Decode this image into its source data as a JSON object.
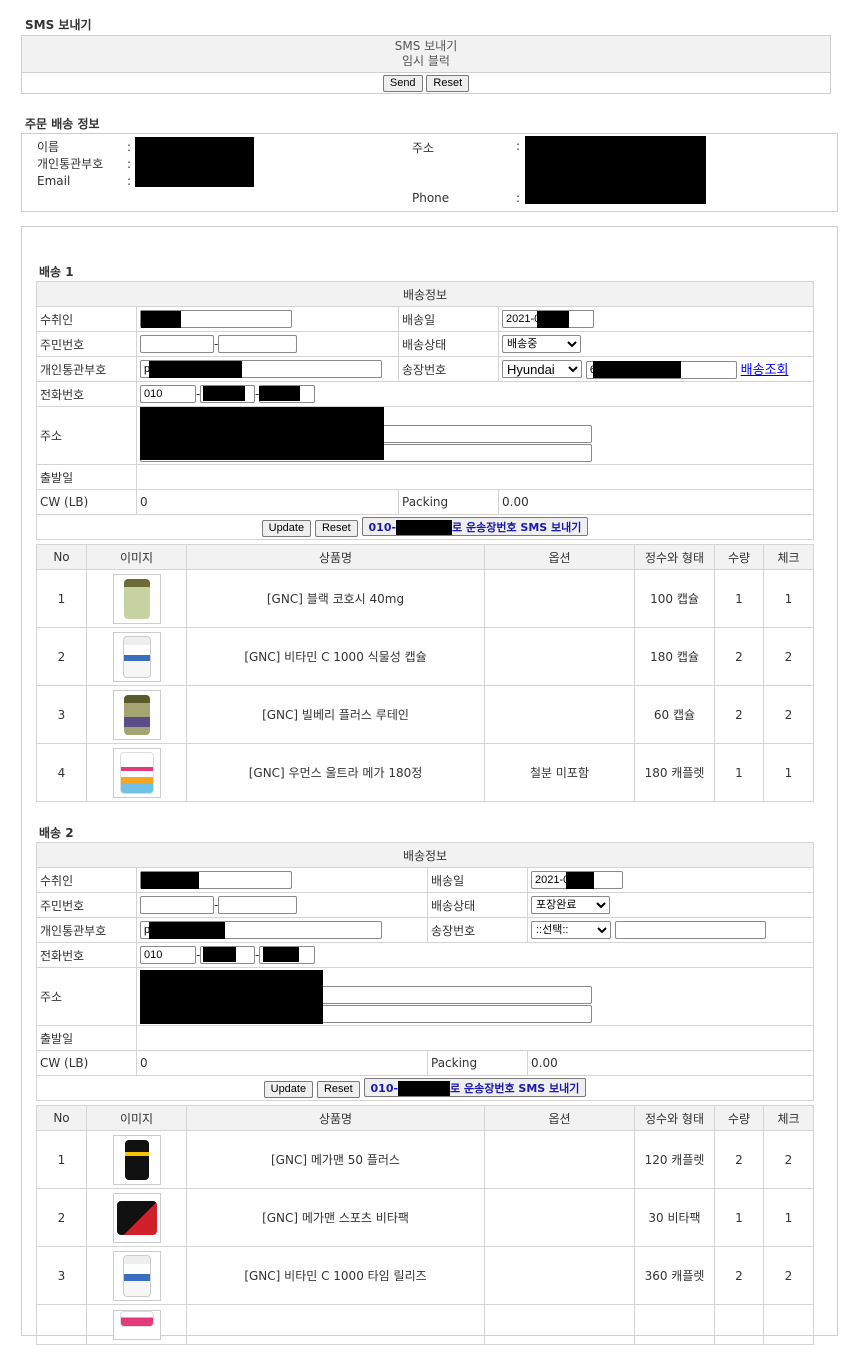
{
  "sms": {
    "section_title": "SMS 보내기",
    "box_title": "SMS 보내기",
    "box_subtitle": "임시 블럭",
    "send_label": "Send",
    "reset_label": "Reset"
  },
  "order": {
    "section_title": "주문 배송 정보",
    "name_label": "이름",
    "customs_label": "개인통관부호",
    "email_label": "Email",
    "address_label": "주소",
    "phone_label": "Phone",
    "colon": ":"
  },
  "shipments": [
    {
      "title": "배송 1",
      "info_header": "배송정보",
      "recipient_label": "수취인",
      "ship_date_label": "배송일",
      "ship_date_value": "2021-0",
      "ssn_label": "주민번호",
      "status_label": "배송상태",
      "status_value": "배송중",
      "customs_label": "개인통관부호",
      "customs_value": "p",
      "tracking_label": "송장번호",
      "carrier_value": "Hyundai",
      "tracking_value": "6",
      "tracking_link": "배송조회",
      "phone_label": "전화번호",
      "phone_prefix": "010",
      "address_label": "주소",
      "depart_label": "출발일",
      "cw_label": "CW (LB)",
      "cw_value": "0",
      "packing_label": "Packing",
      "packing_value": "0.00",
      "update_label": "Update",
      "reset_label": "Reset",
      "sms_prefix": "010-",
      "sms_suffix": "로 운송장번호 SMS 보내기",
      "products": [
        {
          "no": "1",
          "name": "[GNC] 블랙 코호시 40mg",
          "option": "",
          "form": "100 캡슐",
          "qty": "1",
          "check": "1"
        },
        {
          "no": "2",
          "name": "[GNC] 비타민 C 1000 식물성 캡슐",
          "option": "",
          "form": "180 캡슐",
          "qty": "2",
          "check": "2"
        },
        {
          "no": "3",
          "name": "[GNC] 빌베리 플러스 루테인",
          "option": "",
          "form": "60 캡슐",
          "qty": "2",
          "check": "2"
        },
        {
          "no": "4",
          "name": "[GNC] 우먼스 울트라 메가 180정",
          "option": "철분 미포함",
          "form": "180 캐플렛",
          "qty": "1",
          "check": "1"
        }
      ]
    },
    {
      "title": "배송 2",
      "info_header": "배송정보",
      "recipient_label": "수취인",
      "ship_date_label": "배송일",
      "ship_date_value": "2021-0",
      "ssn_label": "주민번호",
      "status_label": "배송상태",
      "status_value": "포장완료",
      "customs_label": "개인통관부호",
      "customs_value": "p",
      "tracking_label": "송장번호",
      "carrier_value": "::선택::",
      "tracking_value": "",
      "tracking_link": "",
      "phone_label": "전화번호",
      "phone_prefix": "010",
      "address_label": "주소",
      "depart_label": "출발일",
      "cw_label": "CW (LB)",
      "cw_value": "0",
      "packing_label": "Packing",
      "packing_value": "0.00",
      "update_label": "Update",
      "reset_label": "Reset",
      "sms_prefix": "010-",
      "sms_suffix": "로 운송장번호 SMS 보내기",
      "products": [
        {
          "no": "1",
          "name": "[GNC] 메가맨 50 플러스",
          "option": "",
          "form": "120 캐플렛",
          "qty": "2",
          "check": "2"
        },
        {
          "no": "2",
          "name": "[GNC] 메가맨 스포츠 비타팩",
          "option": "",
          "form": "30 비타팩",
          "qty": "1",
          "check": "1"
        },
        {
          "no": "3",
          "name": "[GNC] 비타민 C 1000 타임 릴리즈",
          "option": "",
          "form": "360 캐플렛",
          "qty": "2",
          "check": "2"
        }
      ]
    }
  ],
  "product_columns": [
    "No",
    "이미지",
    "상품명",
    "옵션",
    "정수와 형태",
    "수량",
    "체크"
  ]
}
